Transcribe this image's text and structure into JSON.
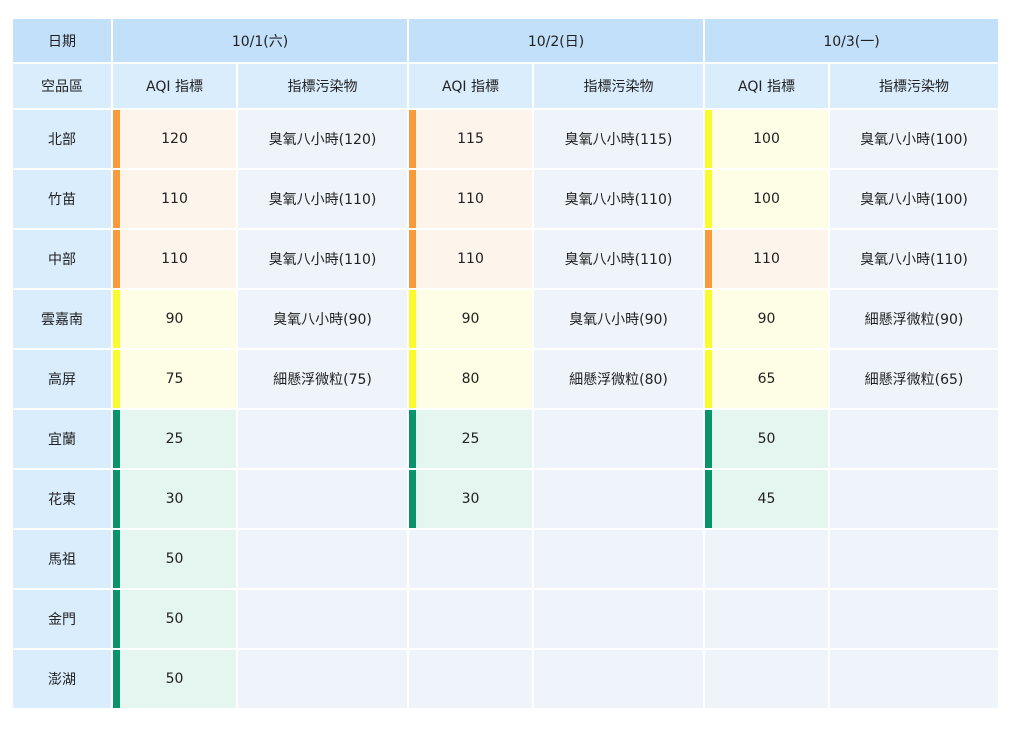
{
  "header": {
    "date_label": "日期",
    "region_label": "空品區",
    "dates": [
      "10/1(六)",
      "10/2(日)",
      "10/3(一)"
    ],
    "aqi_label": "AQI 指標",
    "pollutant_label": "指標污染物"
  },
  "colors": {
    "orange": "#f99b3d",
    "yellow": "#fafa2d",
    "green": "#0a936b",
    "header_bg": "#c2e0fa",
    "subheader_bg": "#daedfd",
    "cell_bg": "#eef4fa"
  },
  "rows": [
    {
      "region": "北部",
      "days": [
        {
          "aqi": "120",
          "level": "orange",
          "pollutant": "臭氧八小時(120)"
        },
        {
          "aqi": "115",
          "level": "orange",
          "pollutant": "臭氧八小時(115)"
        },
        {
          "aqi": "100",
          "level": "yellow",
          "pollutant": "臭氧八小時(100)"
        }
      ]
    },
    {
      "region": "竹苗",
      "days": [
        {
          "aqi": "110",
          "level": "orange",
          "pollutant": "臭氧八小時(110)"
        },
        {
          "aqi": "110",
          "level": "orange",
          "pollutant": "臭氧八小時(110)"
        },
        {
          "aqi": "100",
          "level": "yellow",
          "pollutant": "臭氧八小時(100)"
        }
      ]
    },
    {
      "region": "中部",
      "days": [
        {
          "aqi": "110",
          "level": "orange",
          "pollutant": "臭氧八小時(110)"
        },
        {
          "aqi": "110",
          "level": "orange",
          "pollutant": "臭氧八小時(110)"
        },
        {
          "aqi": "110",
          "level": "orange",
          "pollutant": "臭氧八小時(110)"
        }
      ]
    },
    {
      "region": "雲嘉南",
      "days": [
        {
          "aqi": "90",
          "level": "yellow",
          "pollutant": "臭氧八小時(90)"
        },
        {
          "aqi": "90",
          "level": "yellow",
          "pollutant": "臭氧八小時(90)"
        },
        {
          "aqi": "90",
          "level": "yellow",
          "pollutant": "細懸浮微粒(90)"
        }
      ]
    },
    {
      "region": "高屏",
      "days": [
        {
          "aqi": "75",
          "level": "yellow",
          "pollutant": "細懸浮微粒(75)"
        },
        {
          "aqi": "80",
          "level": "yellow",
          "pollutant": "細懸浮微粒(80)"
        },
        {
          "aqi": "65",
          "level": "yellow",
          "pollutant": "細懸浮微粒(65)"
        }
      ]
    },
    {
      "region": "宜蘭",
      "days": [
        {
          "aqi": "25",
          "level": "green",
          "pollutant": ""
        },
        {
          "aqi": "25",
          "level": "green",
          "pollutant": ""
        },
        {
          "aqi": "50",
          "level": "green",
          "pollutant": ""
        }
      ]
    },
    {
      "region": "花東",
      "days": [
        {
          "aqi": "30",
          "level": "green",
          "pollutant": ""
        },
        {
          "aqi": "30",
          "level": "green",
          "pollutant": ""
        },
        {
          "aqi": "45",
          "level": "green",
          "pollutant": ""
        }
      ]
    },
    {
      "region": "馬祖",
      "days": [
        {
          "aqi": "50",
          "level": "green",
          "pollutant": ""
        },
        {
          "aqi": "",
          "level": "",
          "pollutant": ""
        },
        {
          "aqi": "",
          "level": "",
          "pollutant": ""
        }
      ]
    },
    {
      "region": "金門",
      "days": [
        {
          "aqi": "50",
          "level": "green",
          "pollutant": ""
        },
        {
          "aqi": "",
          "level": "",
          "pollutant": ""
        },
        {
          "aqi": "",
          "level": "",
          "pollutant": ""
        }
      ]
    },
    {
      "region": "澎湖",
      "days": [
        {
          "aqi": "50",
          "level": "green",
          "pollutant": ""
        },
        {
          "aqi": "",
          "level": "",
          "pollutant": ""
        },
        {
          "aqi": "",
          "level": "",
          "pollutant": ""
        }
      ]
    }
  ]
}
